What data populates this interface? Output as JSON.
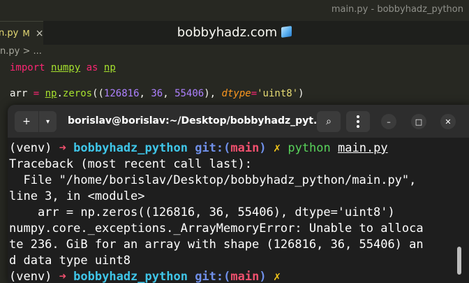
{
  "editor": {
    "window_title": "main.py - bobbyhadz_python",
    "tab": {
      "name": "n.py",
      "modified": "M",
      "close": "×"
    },
    "brand": "bobbyhadz.com",
    "breadcrumb": "n.py > ...",
    "code": {
      "line1": {
        "kw": "import",
        "mod": "numpy",
        "as": "as",
        "alias": "np"
      },
      "line2": {
        "var": "arr",
        "eq": "=",
        "obj": "np",
        "fn": "zeros",
        "n1": "126816",
        "n2": "36",
        "n3": "55406",
        "param": "dtype",
        "value": "'uint8'"
      }
    }
  },
  "terminal": {
    "title": "borislav@borislav:~/Desktop/bobbyhadz_pyt...",
    "buttons": {
      "new_tab": "+",
      "dropdown": "▾",
      "search": "⌕",
      "minimize": "–",
      "maximize": "□",
      "close": "✕"
    },
    "prompt": {
      "venv": "(venv)",
      "arrow": "➜",
      "dir": "bobbyhadz_python",
      "git": "git:(",
      "branch": "main",
      "git_close": ")",
      "dirty": "✗"
    },
    "command": {
      "program": "python",
      "argument": "main.py"
    },
    "output": [
      "Traceback (most recent call last):",
      "  File \"/home/borislav/Desktop/bobbyhadz_python/main.py\",",
      "line 3, in <module>",
      "    arr = np.zeros((126816, 36, 55406), dtype='uint8')",
      "numpy.core._exceptions._ArrayMemoryError: Unable to alloca",
      "te 236. GiB for an array with shape (126816, 36, 55406) an",
      "d data type uint8"
    ]
  },
  "colors": {
    "editor_bg": "#272822",
    "terminal_bg": "#1e1e1e",
    "prompt_arrow": "#f0506e",
    "prompt_dir": "#3fc5e8",
    "prompt_git": "#6f8fe8",
    "prompt_dirty": "#f0c419",
    "command": "#58d25a"
  }
}
